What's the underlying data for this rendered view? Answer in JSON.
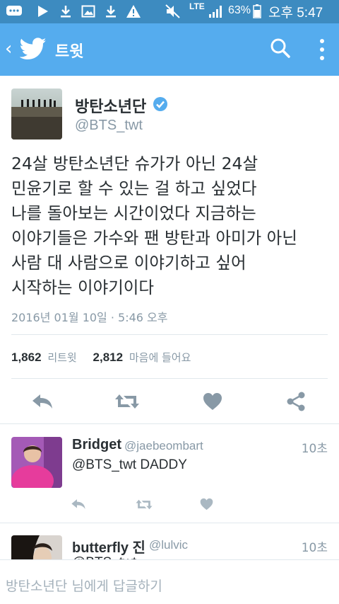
{
  "status_bar": {
    "network": "LTE",
    "battery": "63%",
    "time": "오후 5:47",
    "icons": [
      "chat-bubble-icon",
      "play-icon",
      "download-icon",
      "image-icon",
      "download-icon",
      "warning-icon",
      "mute-icon",
      "signal-icon",
      "battery-icon"
    ]
  },
  "app_bar": {
    "title": "트윗",
    "back_icon": "chevron-left-icon",
    "logo": "twitter-bird-icon",
    "search_icon": "search-icon",
    "menu_icon": "more-vertical-icon",
    "color": "#55acee"
  },
  "tweet": {
    "author_name": "방탄소년단",
    "author_handle": "@BTS_twt",
    "verified": true,
    "text_lines": [
      "24살 방탄소년단 슈가가 아닌 24살",
      "민윤기로 할 수 있는 걸 하고 싶었다",
      "나를 돌아보는 시간이었다 지금하는",
      "이야기들은 가수와 팬 방탄과 아미가 아닌",
      "사람 대 사람으로 이야기하고 싶어",
      "시작하는 이야기이다"
    ],
    "timestamp": "2016년 01월 10일 · 5:46 오후",
    "retweet_count": "1,862",
    "retweet_label": "리트윗",
    "like_count": "2,812",
    "like_label": "마음에 들어요",
    "actions": [
      "reply-icon",
      "retweet-icon",
      "heart-icon",
      "share-icon"
    ]
  },
  "replies": [
    {
      "name": "Bridget",
      "handle": "@jaebeombart",
      "time": "10초",
      "text": "@BTS_twt DADDY"
    },
    {
      "name": "butterfly 진",
      "handle": "@lulvic",
      "time": "10초",
      "text": "@BTS_twt"
    }
  ],
  "compose": {
    "placeholder": "방탄소년단 님에게 답글하기"
  },
  "colors": {
    "status_bar": "#3d8bc0",
    "accent": "#55acee",
    "action_icon": "#8899a6"
  }
}
